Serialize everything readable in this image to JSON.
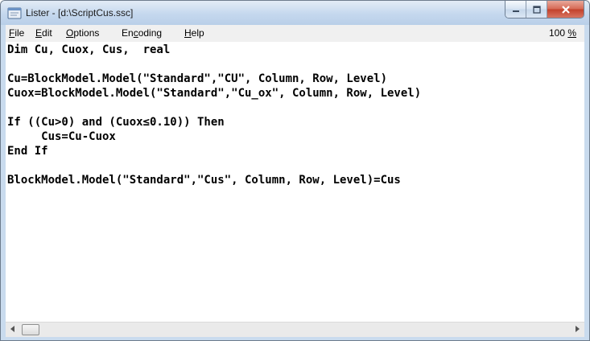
{
  "window": {
    "title": "Lister - [d:\\ScriptCus.ssc]",
    "icon": "document-window-icon"
  },
  "caption_buttons": {
    "minimize": "minimize-icon",
    "maximize": "maximize-icon",
    "close": "close-icon"
  },
  "menu": {
    "items": [
      {
        "label_underlined": "F",
        "label_rest": "ile"
      },
      {
        "label_underlined": "E",
        "label_rest": "dit"
      },
      {
        "label_underlined": "O",
        "label_rest": "ptions"
      },
      {
        "label_prefix": "En",
        "label_underlined": "c",
        "label_rest": "oding"
      },
      {
        "label_underlined": "H",
        "label_rest": "elp"
      }
    ],
    "zoom_value": "100 ",
    "zoom_unit": "%"
  },
  "code": {
    "lines": [
      "Dim Cu, Cuox, Cus,  real",
      "",
      "Cu=BlockModel.Model(\"Standard\",\"CU\", Column, Row, Level)",
      "Cuox=BlockModel.Model(\"Standard\",\"Cu_ox\", Column, Row, Level)",
      "",
      "If ((Cu>0) and (Cuox≤0.10)) Then",
      "     Cus=Cu-Cuox",
      "End If",
      "",
      "BlockModel.Model(\"Standard\",\"Cus\", Column, Row, Level)=Cus"
    ]
  },
  "scrollbar": {
    "left_icon": "scroll-left-arrow-icon",
    "right_icon": "scroll-right-arrow-icon"
  }
}
